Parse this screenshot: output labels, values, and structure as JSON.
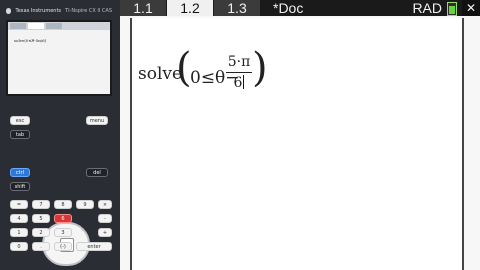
{
  "handheld": {
    "brand": "Texas Instruments",
    "model": "TI-Nspire CX II CAS",
    "mini_expression": "solve(0≤θ-5π/6)",
    "keys": [
      {
        "label": "esc",
        "style": "light"
      },
      {
        "label": "tab",
        "style": "dark"
      },
      {
        "label": "menu",
        "style": "light"
      },
      {
        "label": "ctrl",
        "style": "blue"
      },
      {
        "label": "shift",
        "style": "dark"
      },
      {
        "label": "del",
        "style": "dark"
      },
      {
        "label": "=",
        "style": "light"
      },
      {
        "label": "7",
        "style": "light"
      },
      {
        "label": "8",
        "style": "light"
      },
      {
        "label": "9",
        "style": "light"
      },
      {
        "label": "×",
        "style": "light"
      },
      {
        "label": "4",
        "style": "light"
      },
      {
        "label": "5",
        "style": "light"
      },
      {
        "label": "6",
        "style": "red"
      },
      {
        "label": "-",
        "style": "light"
      },
      {
        "label": "1",
        "style": "light"
      },
      {
        "label": "2",
        "style": "light"
      },
      {
        "label": "3",
        "style": "light"
      },
      {
        "label": "+",
        "style": "light"
      },
      {
        "label": "0",
        "style": "light"
      },
      {
        "label": ".",
        "style": "light"
      },
      {
        "label": "(-)",
        "style": "light"
      },
      {
        "label": "enter",
        "style": "light"
      }
    ]
  },
  "main": {
    "tabs": [
      {
        "label": "1.1",
        "active": false
      },
      {
        "label": "1.2",
        "active": true
      },
      {
        "label": "1.3",
        "active": false
      }
    ],
    "doc_title": "*Doc",
    "angle_mode": "RAD",
    "close_icon": "✕",
    "expression": {
      "fn": "solve",
      "left_paren": "(",
      "lhs": "0≤θ−",
      "numerator": "5·π",
      "denominator": "6",
      "right_paren": ")"
    }
  }
}
